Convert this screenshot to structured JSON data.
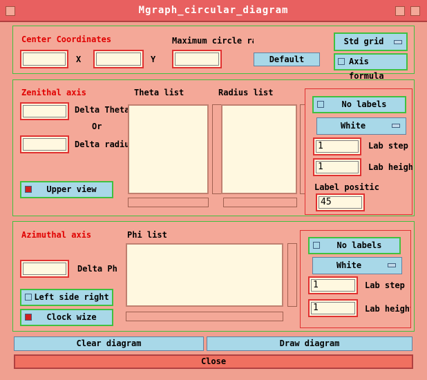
{
  "window": {
    "title": "Mgraph_circular_diagram"
  },
  "center": {
    "heading": "Center Coordinates",
    "x_label": "X",
    "y_label": "Y",
    "x_value": "",
    "y_value": "",
    "max_radius_label": "Maximum circle ra",
    "max_radius_value": "",
    "default_button": "Default",
    "grid_menu": "Std grid",
    "axis_formula_label": "Axis formula"
  },
  "zenithal": {
    "heading": "Zenithal axis",
    "delta_theta_label": "Delta Theta",
    "or_label": "Or",
    "delta_radius_label": "Delta radiu",
    "theta_list_label": "Theta list",
    "radius_list_label": "Radius list",
    "upper_view_label": "Upper view",
    "no_labels": "No labels",
    "color_menu": "White",
    "lab_step_label": "Lab step",
    "lab_step_value": "1",
    "lab_height_label": "Lab heigh",
    "lab_height_value": "1",
    "label_position_label": "Label positic",
    "label_position_value": "45"
  },
  "azimuthal": {
    "heading": "Azimuthal axis",
    "delta_phi_label": "Delta Ph:",
    "phi_list_label": "Phi list",
    "left_side_right_label": "Left side right",
    "clock_wize_label": "Clock wize",
    "no_labels": "No labels",
    "color_menu": "White",
    "lab_step_label": "Lab step",
    "lab_step_value": "1",
    "lab_height_label": "Lab height",
    "lab_height_value": "1"
  },
  "actions": {
    "clear": "Clear diagram",
    "draw": "Draw diagram",
    "close": "Close"
  }
}
